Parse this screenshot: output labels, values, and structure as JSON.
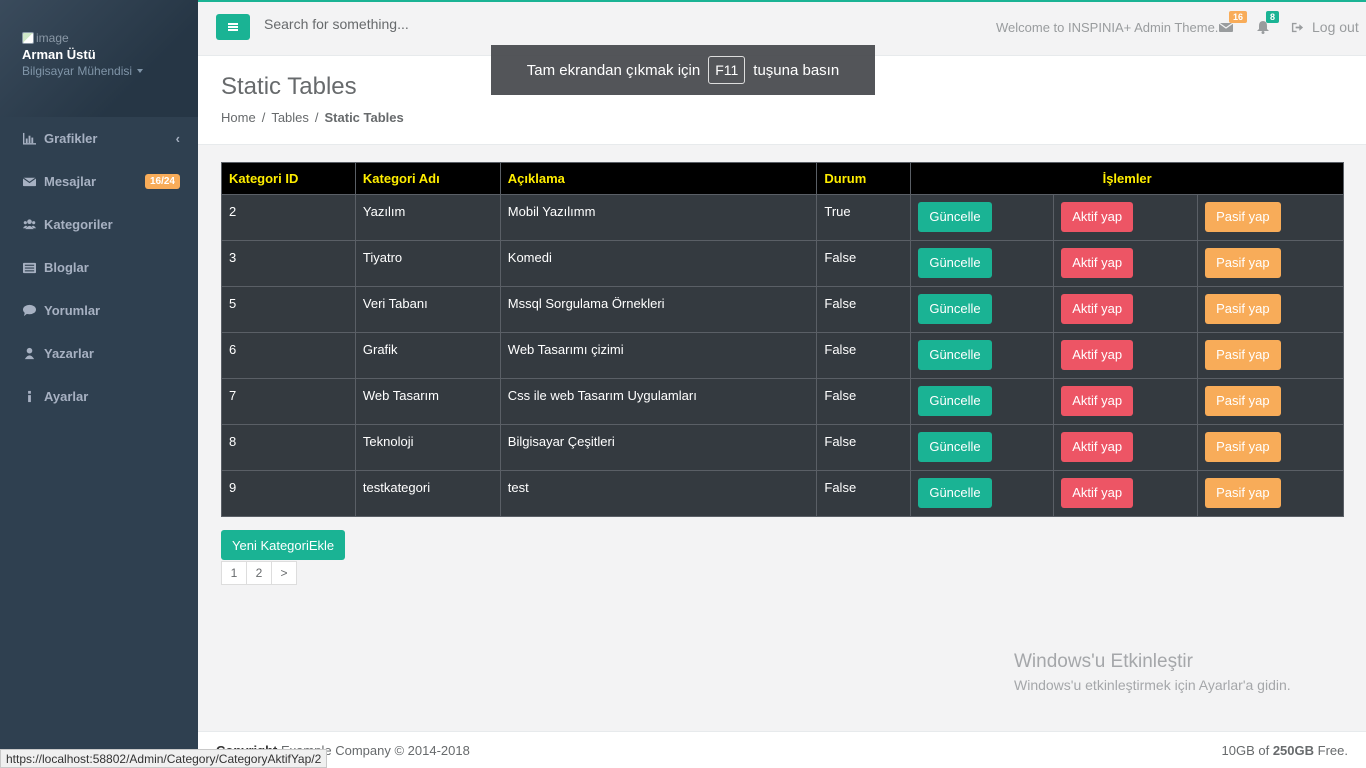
{
  "sidebar": {
    "profile": {
      "image_alt": "image",
      "name": "Arman Üstü",
      "role": "Bilgisayar Mühendisi"
    },
    "items": [
      {
        "label": "Grafikler",
        "icon": "bar-chart-icon",
        "right": "‹"
      },
      {
        "label": "Mesajlar",
        "icon": "envelope-icon",
        "badge": "16/24"
      },
      {
        "label": "Kategoriler",
        "icon": "users-icon"
      },
      {
        "label": "Bloglar",
        "icon": "list-icon"
      },
      {
        "label": "Yorumlar",
        "icon": "comment-icon"
      },
      {
        "label": "Yazarlar",
        "icon": "user-icon"
      },
      {
        "label": "Ayarlar",
        "icon": "info-icon"
      }
    ]
  },
  "topbar": {
    "search_placeholder": "Search for something...",
    "welcome": "Welcome to INSPINIA+ Admin Theme.",
    "mail_count": "16",
    "bell_count": "8",
    "logout": "Log out"
  },
  "heading": {
    "title": "Static Tables",
    "breadcrumb": [
      "Home",
      "Tables",
      "Static Tables"
    ]
  },
  "overlay": {
    "before": "Tam ekrandan çıkmak için",
    "key": "F11",
    "after": "tuşuna basın"
  },
  "table": {
    "headers": [
      "Kategori ID",
      "Kategori Adı",
      "Açıklama",
      "Durum",
      "İşlemler"
    ],
    "actions": {
      "update": "Güncelle",
      "activate": "Aktif yap",
      "deactivate": "Pasif yap"
    },
    "rows": [
      {
        "id": "2",
        "name": "Yazılım",
        "desc": "Mobil Yazılımm",
        "status": "True"
      },
      {
        "id": "3",
        "name": "Tiyatro",
        "desc": "Komedi",
        "status": "False"
      },
      {
        "id": "5",
        "name": "Veri Tabanı",
        "desc": "Mssql Sorgulama Örnekleri",
        "status": "False"
      },
      {
        "id": "6",
        "name": "Grafik",
        "desc": "Web Tasarımı çizimi",
        "status": "False"
      },
      {
        "id": "7",
        "name": "Web Tasarım",
        "desc": "Css ile web Tasarım Uygulamları",
        "status": "False"
      },
      {
        "id": "8",
        "name": "Teknoloji",
        "desc": "Bilgisayar Çeşitleri",
        "status": "False"
      },
      {
        "id": "9",
        "name": "testkategori",
        "desc": "test",
        "status": "False"
      }
    ]
  },
  "new_button": "Yeni KategoriEkle",
  "pager": [
    "1",
    "2",
    ">"
  ],
  "watermark": {
    "title": "Windows'u Etkinleştir",
    "sub": "Windows'u etkinleştirmek için Ayarlar'a gidin."
  },
  "footer": {
    "copyright_label": "Copyright",
    "copyright_text": "Example Company © 2014-2018",
    "storage_used": "10GB of",
    "storage_total": "250GB",
    "storage_suffix": "Free."
  },
  "status_url": "https://localhost:58802/Admin/Category/CategoryAktifYap/2",
  "colors": {
    "accent": "#1ab394",
    "danger": "#ed5565",
    "warning": "#f8ac59",
    "sidebar": "#2f4050",
    "header_text": "#ffee00"
  }
}
